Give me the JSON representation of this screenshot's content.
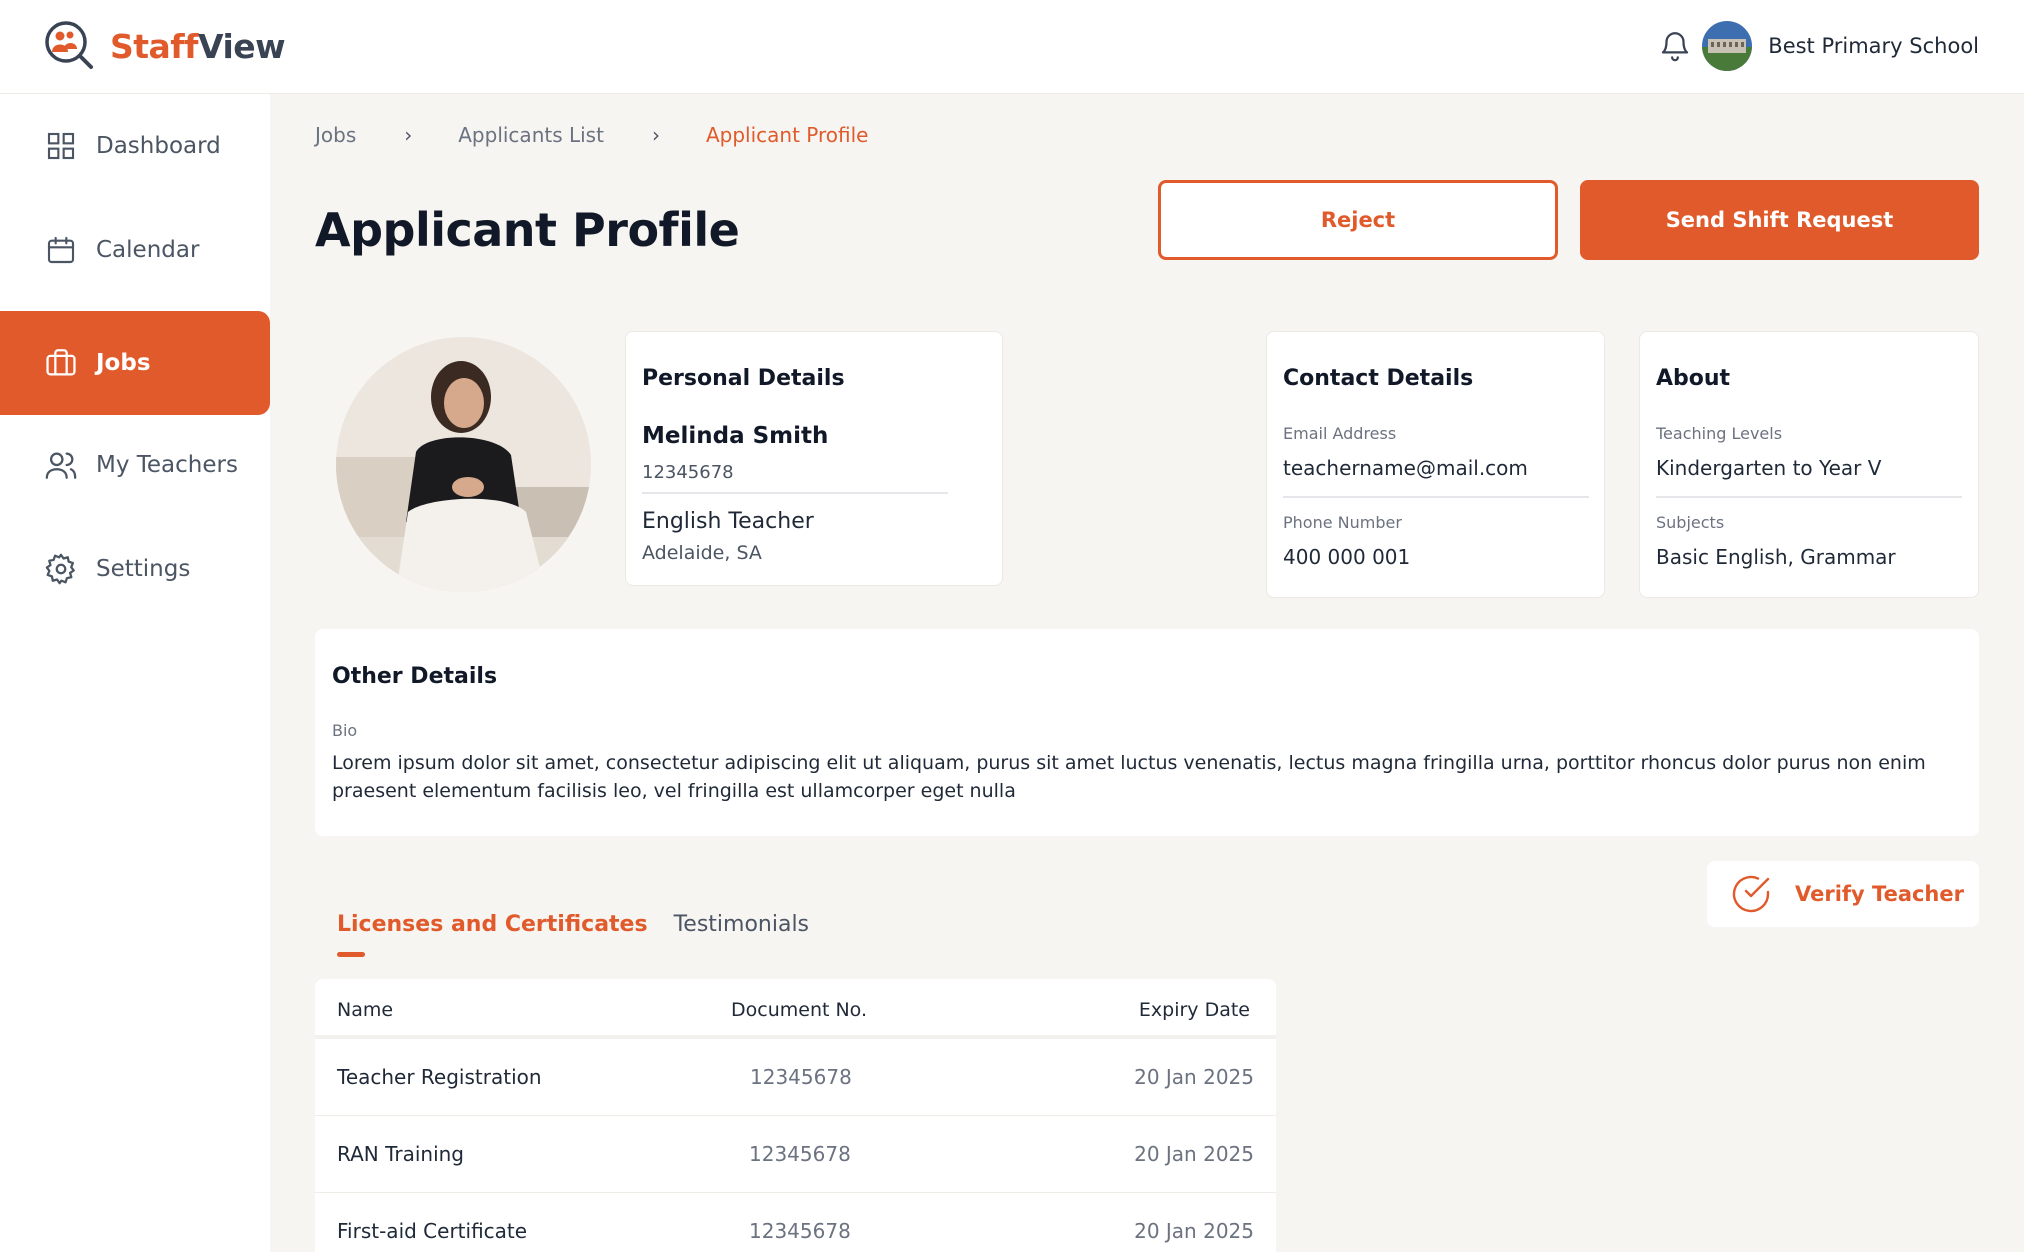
{
  "brand": {
    "name_part1": "Staff",
    "name_part2": "View",
    "color": "#e05a2b"
  },
  "header": {
    "school_name": "Best Primary School",
    "bell_icon": "bell-icon"
  },
  "sidebar": {
    "items": [
      {
        "label": "Dashboard",
        "icon": "grid-icon"
      },
      {
        "label": "Calendar",
        "icon": "calendar-icon"
      },
      {
        "label": "Jobs",
        "icon": "briefcase-icon",
        "active": true
      },
      {
        "label": "My Teachers",
        "icon": "users-icon"
      },
      {
        "label": "Settings",
        "icon": "gear-icon"
      }
    ]
  },
  "breadcrumb": {
    "items": [
      "Jobs",
      "Applicants List",
      "Applicant Profile"
    ],
    "separator": "›"
  },
  "page": {
    "title": "Applicant Profile",
    "reject_label": "Reject",
    "send_label": "Send Shift Request"
  },
  "personal": {
    "title": "Personal Details",
    "name": "Melinda Smith",
    "id": "12345678",
    "role": "English Teacher",
    "location": "Adelaide, SA"
  },
  "contact": {
    "title": "Contact Details",
    "email_label": "Email Address",
    "email": "teachername@mail.com",
    "phone_label": "Phone Number",
    "phone": "400 000 001"
  },
  "about": {
    "title": "About",
    "levels_label": "Teaching Levels",
    "levels": "Kindergarten to Year V",
    "subjects_label": "Subjects",
    "subjects": "Basic English, Grammar"
  },
  "other": {
    "title": "Other Details",
    "bio_label": "Bio",
    "bio": "Lorem ipsum dolor sit amet, consectetur adipiscing elit ut aliquam, purus sit amet luctus venenatis, lectus magna fringilla urna, porttitor rhoncus dolor purus non enim praesent elementum facilisis leo, vel fringilla est ullamcorper eget nulla"
  },
  "verify": {
    "label": "Verify Teacher"
  },
  "tabs": [
    {
      "label": "Licenses and Certificates",
      "active": true
    },
    {
      "label": "Testimonials"
    }
  ],
  "table": {
    "columns": [
      "Name",
      "Document No.",
      "Expiry Date"
    ],
    "rows": [
      {
        "name": "Teacher Registration",
        "doc": "12345678",
        "expiry": "20 Jan 2025"
      },
      {
        "name": "RAN Training",
        "doc": "12345678",
        "expiry": "20 Jan 2025"
      },
      {
        "name": "First-aid Certificate",
        "doc": "12345678",
        "expiry": "20 Jan 2025"
      }
    ]
  }
}
